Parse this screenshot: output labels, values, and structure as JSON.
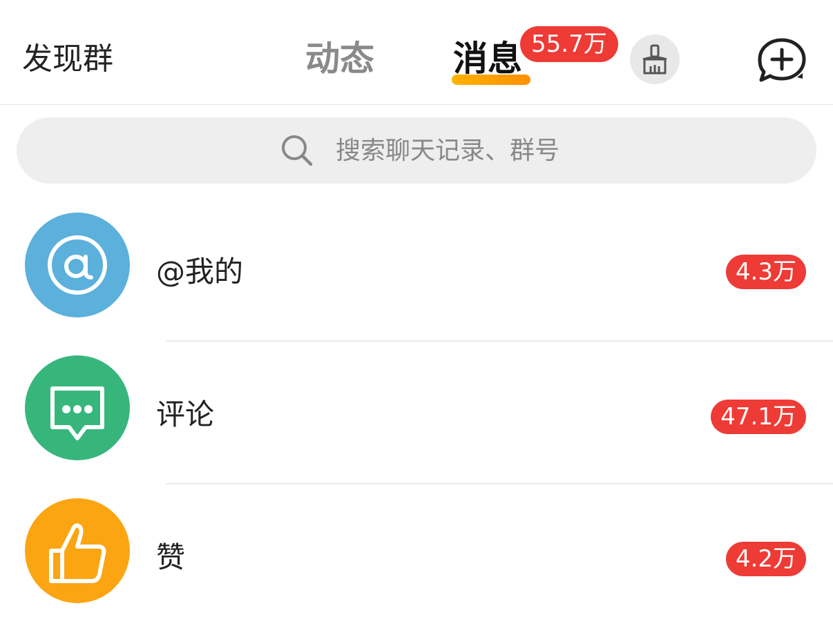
{
  "header": {
    "discover_label": "发现群",
    "tabs": [
      {
        "label": "动态",
        "active": false
      },
      {
        "label": "消息",
        "active": true
      }
    ],
    "messages_badge": "55.7万",
    "accent_color": "#ff9f00",
    "badge_color": "#ee3b36"
  },
  "search": {
    "placeholder": "搜索聊天记录、群号",
    "value": ""
  },
  "list": {
    "items": [
      {
        "label": "@我的",
        "badge": "4.3万",
        "icon": "at-icon",
        "icon_color": "#5bb0dc"
      },
      {
        "label": "评论",
        "badge": "47.1万",
        "icon": "comment-icon",
        "icon_color": "#37b67c"
      },
      {
        "label": "赞",
        "badge": "4.2万",
        "icon": "thumbs-up-icon",
        "icon_color": "#fba513"
      }
    ]
  }
}
